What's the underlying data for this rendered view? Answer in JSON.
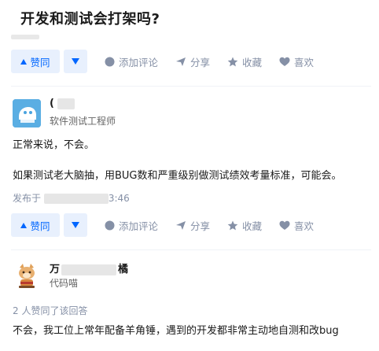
{
  "question": {
    "title": "开发和测试会打架吗?"
  },
  "actions": {
    "vote_up": "赞同",
    "comment": "添加评论",
    "share": "分享",
    "favorite": "收藏",
    "like": "喜欢"
  },
  "answers": [
    {
      "author_name": "(",
      "author_headline": "软件测试工程师",
      "paragraphs": [
        "正常来说，不会。",
        "如果测试老大脑抽，用BUG数和严重级别做测试绩效考量标准，可能会。"
      ],
      "published_prefix": "发布于",
      "published_time_visible": "3:46"
    },
    {
      "author_name_start": "万",
      "author_name_end": "橘",
      "author_headline": "代码喵",
      "vote_summary": "2 人赞同了该回答",
      "paragraphs": [
        "不会，我工位上常年配备羊角锤，遇到的开发都非常主动地自测和改bug"
      ]
    }
  ],
  "colors": {
    "accent": "#0066ff",
    "muted": "#8590a6",
    "vote_bg": "#e8f0fd"
  }
}
